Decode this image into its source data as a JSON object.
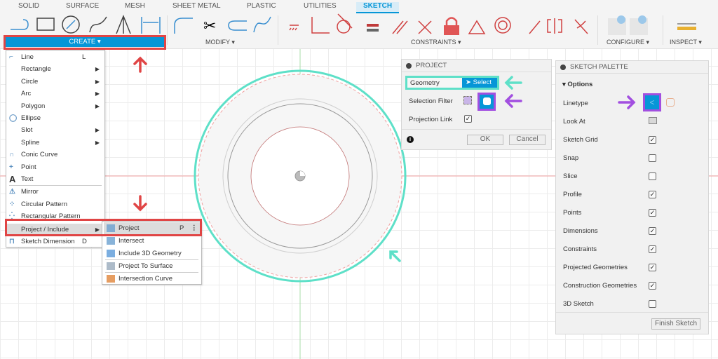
{
  "tabs": [
    "SOLID",
    "SURFACE",
    "MESH",
    "SHEET METAL",
    "PLASTIC",
    "UTILITIES",
    "SKETCH"
  ],
  "active_tab": "SKETCH",
  "groups": {
    "create": "CREATE ▾",
    "modify": "MODIFY ▾",
    "constraints": "CONSTRAINTS ▾",
    "configure": "CONFIGURE ▾",
    "inspect": "INSPECT ▾"
  },
  "create_menu": [
    {
      "label": "Line",
      "shortcut": "L",
      "icon": "line-icon"
    },
    {
      "label": "Rectangle",
      "submenu": true
    },
    {
      "label": "Circle",
      "submenu": true
    },
    {
      "label": "Arc",
      "submenu": true
    },
    {
      "label": "Polygon",
      "submenu": true
    },
    {
      "label": "Ellipse",
      "icon": "ellipse-icon"
    },
    {
      "label": "Slot",
      "submenu": true
    },
    {
      "label": "Spline",
      "submenu": true
    },
    {
      "label": "Conic Curve",
      "icon": "conic-icon"
    },
    {
      "label": "Point",
      "icon": "point-icon"
    },
    {
      "label": "Text",
      "icon": "text-icon"
    },
    {
      "label": "Mirror",
      "icon": "mirror-icon"
    },
    {
      "label": "Circular Pattern",
      "icon": "circular-pattern-icon"
    },
    {
      "label": "Rectangular Pattern",
      "icon": "rectangular-pattern-icon"
    },
    {
      "label": "Project / Include",
      "submenu": true,
      "highlighted": true
    },
    {
      "label": "Sketch Dimension",
      "shortcut": "D",
      "icon": "dimension-icon"
    }
  ],
  "project_submenu": [
    {
      "label": "Project",
      "shortcut": "P",
      "highlighted": true
    },
    {
      "label": "Intersect"
    },
    {
      "label": "Include 3D Geometry"
    },
    {
      "label": "Project To Surface"
    },
    {
      "label": "Intersection Curve"
    }
  ],
  "project_panel": {
    "title": "PROJECT",
    "geometry_label": "Geometry",
    "select_label": "Select",
    "filter_label": "Selection Filter",
    "link_label": "Projection Link",
    "link_checked": true,
    "ok": "OK",
    "cancel": "Cancel"
  },
  "sketch_palette": {
    "title": "SKETCH PALETTE",
    "options_label": "Options",
    "linetype_label": "Linetype",
    "look_at_label": "Look At",
    "options": [
      {
        "label": "Sketch Grid",
        "checked": true
      },
      {
        "label": "Snap",
        "checked": false
      },
      {
        "label": "Slice",
        "checked": false
      },
      {
        "label": "Profile",
        "checked": true
      },
      {
        "label": "Points",
        "checked": true
      },
      {
        "label": "Dimensions",
        "checked": true
      },
      {
        "label": "Constraints",
        "checked": true
      },
      {
        "label": "Projected Geometries",
        "checked": true
      },
      {
        "label": "Construction Geometries",
        "checked": true
      },
      {
        "label": "3D Sketch",
        "checked": false
      }
    ],
    "finish": "Finish Sketch"
  },
  "colors": {
    "accent": "#0696d7",
    "annotation_red": "#e04545",
    "annotation_teal": "#5ee0c8",
    "annotation_purple": "#a24fe0"
  }
}
